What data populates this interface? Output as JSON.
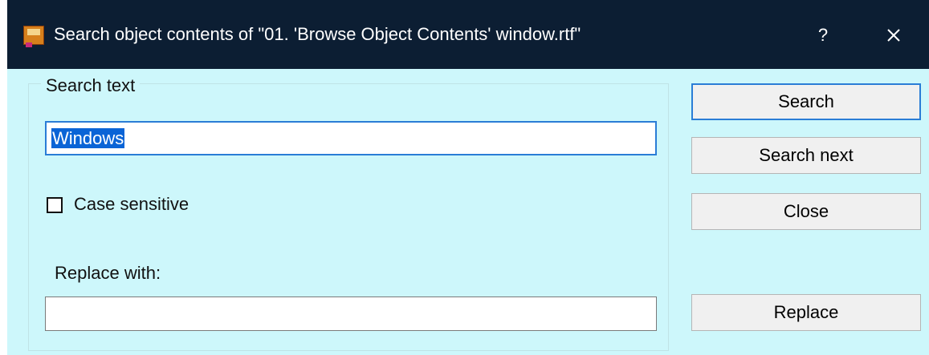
{
  "window": {
    "title": "Search object contents of \"01. 'Browse Object Contents' window.rtf\"",
    "help_label": "?",
    "app_icon": "app-document-icon",
    "close_icon": "close-x-icon"
  },
  "search": {
    "group_label": "Search text",
    "value": "Windows",
    "case_sensitive_label": "Case sensitive",
    "case_sensitive_checked": false
  },
  "replace": {
    "label": "Replace with:",
    "value": ""
  },
  "buttons": {
    "search": "Search",
    "search_next": "Search next",
    "close": "Close",
    "replace": "Replace"
  },
  "colors": {
    "titlebar": "#0c1e33",
    "dialog_background": "#cdf7fb",
    "selection": "#0a64d6",
    "focus_border": "#2a7dd6"
  }
}
